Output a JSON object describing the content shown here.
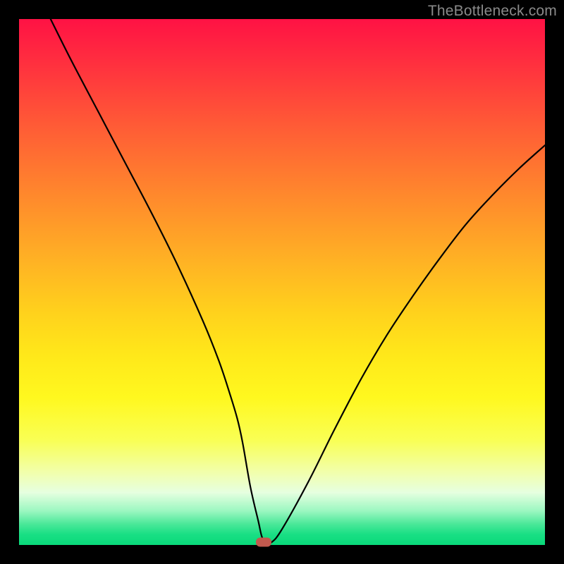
{
  "watermark": "TheBottleneck.com",
  "chart_data": {
    "type": "line",
    "title": "",
    "xlabel": "",
    "ylabel": "",
    "xlim": [
      0,
      100
    ],
    "ylim": [
      0,
      100
    ],
    "grid": false,
    "legend": false,
    "series": [
      {
        "name": "curve",
        "x": [
          6,
          10,
          15,
          20,
          25,
          30,
          35,
          38,
          40,
          41.5,
          42.5,
          44,
          45.5,
          46.2,
          47,
          48,
          50,
          55,
          60,
          65,
          70,
          75,
          80,
          85,
          90,
          95,
          100
        ],
        "values": [
          100,
          92,
          82.5,
          73,
          63.5,
          53.5,
          42.5,
          35,
          29,
          24,
          19.5,
          11,
          4.5,
          1.5,
          0.5,
          0.5,
          3,
          12,
          22,
          31.5,
          40,
          47.5,
          54.5,
          61,
          66.5,
          71.5,
          76
        ]
      }
    ],
    "marker": {
      "x": 46.5,
      "y": 0.5,
      "color": "#c1594e"
    },
    "background_gradient": {
      "top": "#ff1244",
      "mid": "#ffe81a",
      "bottom": "#0ad97a"
    }
  }
}
